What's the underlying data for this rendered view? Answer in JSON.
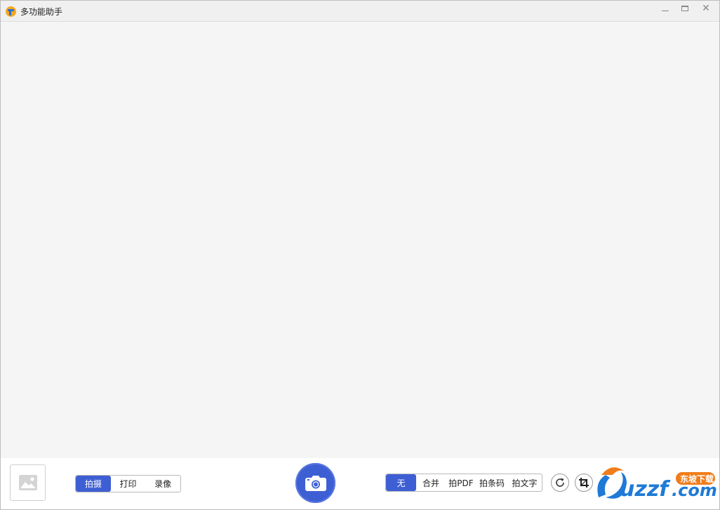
{
  "window": {
    "title": "多功能助手"
  },
  "capture_modes": {
    "items": [
      "拍摄",
      "打印",
      "录像"
    ],
    "active": "拍摄"
  },
  "merge_options": {
    "items": [
      "无",
      "合并",
      "拍PDF",
      "拍条码",
      "拍文字"
    ],
    "active": "无"
  },
  "icons": {
    "app": "app-logo-icon",
    "thumbnail": "image-placeholder-icon",
    "shutter": "camera-icon",
    "rotate": "rotate-icon",
    "crop": "crop-icon",
    "window_min": "minimize-icon",
    "window_max": "maximize-icon",
    "window_close": "close-icon"
  },
  "watermark": {
    "brand": "uzzf.com",
    "tag": "东坡下载"
  },
  "colors": {
    "accent": "#3e5fd4",
    "preview_bg": "#f5f5f5",
    "titlebar_bg": "#f0f0f0",
    "watermark_blue": "#1e7ad6",
    "watermark_orange": "#f07d1a"
  }
}
